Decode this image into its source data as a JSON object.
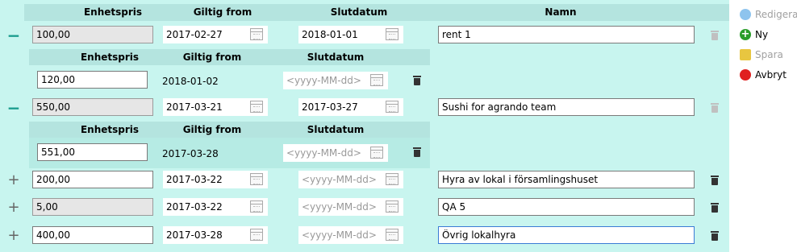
{
  "headers": {
    "unit_price": "Enhetspris",
    "valid_from": "Giltig from",
    "end_date": "Slutdatum",
    "name": "Namn"
  },
  "date_placeholder": "<yyyy-MM-dd>",
  "rows": [
    {
      "toggle": "−",
      "unit_price": "100,00",
      "valid_from": "2017-02-27",
      "end_date": "2018-01-01",
      "name": "rent 1",
      "history": {
        "unit_price": "120,00",
        "valid_from": "2018-01-02"
      }
    },
    {
      "toggle": "−",
      "unit_price": "550,00",
      "valid_from": "2017-03-21",
      "end_date": "2017-03-27",
      "name": "Sushi for agrando team",
      "history": {
        "unit_price": "551,00",
        "valid_from": "2017-03-28"
      }
    },
    {
      "toggle": "+",
      "unit_price": "200,00",
      "valid_from": "2017-03-22",
      "name": "Hyra av lokal i församlingshuset"
    },
    {
      "toggle": "+",
      "unit_price": "5,00",
      "valid_from": "2017-03-22",
      "name": "QA 5"
    },
    {
      "toggle": "+",
      "unit_price": "400,00",
      "valid_from": "2017-03-28",
      "name": "Övrig lokalhyra"
    }
  ],
  "actions": {
    "edit": "Redigera",
    "new": "Ny",
    "save": "Spara",
    "cancel": "Avbryt"
  },
  "colors": {
    "edit": "#8ec4ee",
    "new": "#2a9d2a",
    "save": "#e8c640",
    "cancel": "#e02020"
  }
}
